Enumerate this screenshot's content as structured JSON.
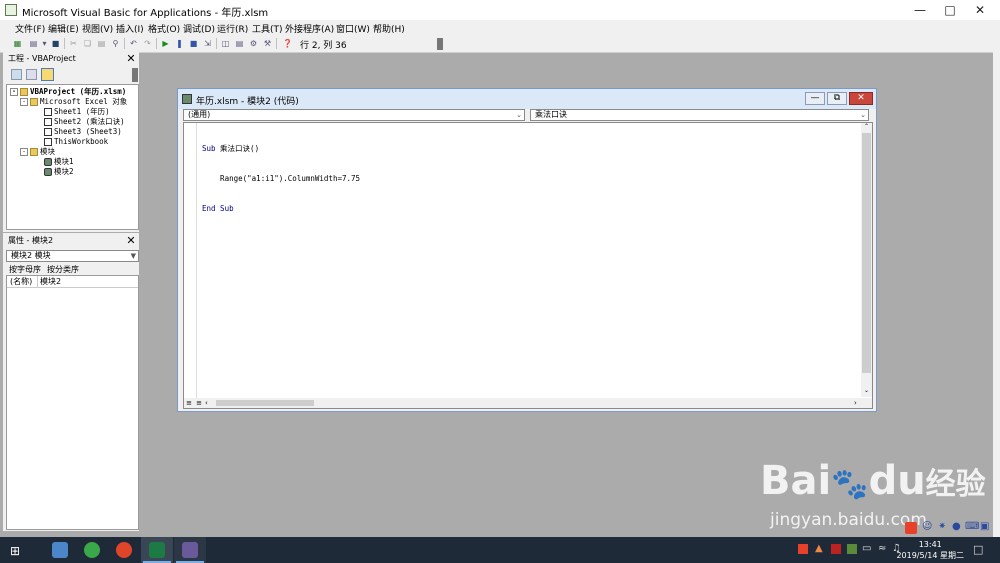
{
  "window": {
    "title": "Microsoft Visual Basic for Applications - 年历.xlsm"
  },
  "menu": [
    "文件(F)",
    "编辑(E)",
    "视图(V)",
    "插入(I)",
    "格式(O)",
    "调试(D)",
    "运行(R)",
    "工具(T)",
    "外接程序(A)",
    "窗口(W)",
    "帮助(H)"
  ],
  "toolbar": {
    "status": "行 2, 列 36"
  },
  "project_pane": {
    "title": "工程 - VBAProject",
    "tree": {
      "root": "VBAProject (年历.xlsm)",
      "excel_objects": "Microsoft Excel 对象",
      "sheet1": "Sheet1 (年历)",
      "sheet2": "Sheet2 (乘法口诀)",
      "sheet3": "Sheet3 (Sheet3)",
      "workbook": "ThisWorkbook",
      "modules": "模块",
      "module1": "模块1",
      "module2": "模块2"
    }
  },
  "properties_pane": {
    "title": "属性 - 模块2",
    "object_select": "模块2 模块",
    "tab_alpha": "按字母序",
    "tab_category": "按分类序",
    "prop_name": "(名称)",
    "prop_value": "模块2"
  },
  "code_window": {
    "title": "年历.xlsm - 模块2 (代码)",
    "object_combo": "(通用)",
    "proc_combo": "乘法口诀",
    "code": {
      "line1_kw": "Sub",
      "line1_rest": " 乘法口诀()",
      "line2": "    Range(\"a1:i1\").ColumnWidth=7.75",
      "line3": "End Sub"
    }
  },
  "taskbar": {
    "time": "13:41",
    "date": "2019/5/14 星期二"
  },
  "watermark": {
    "brand": "Bai",
    "brand_du": "du",
    "brand_cn": "经验",
    "url": "jingyan.baidu.com"
  }
}
